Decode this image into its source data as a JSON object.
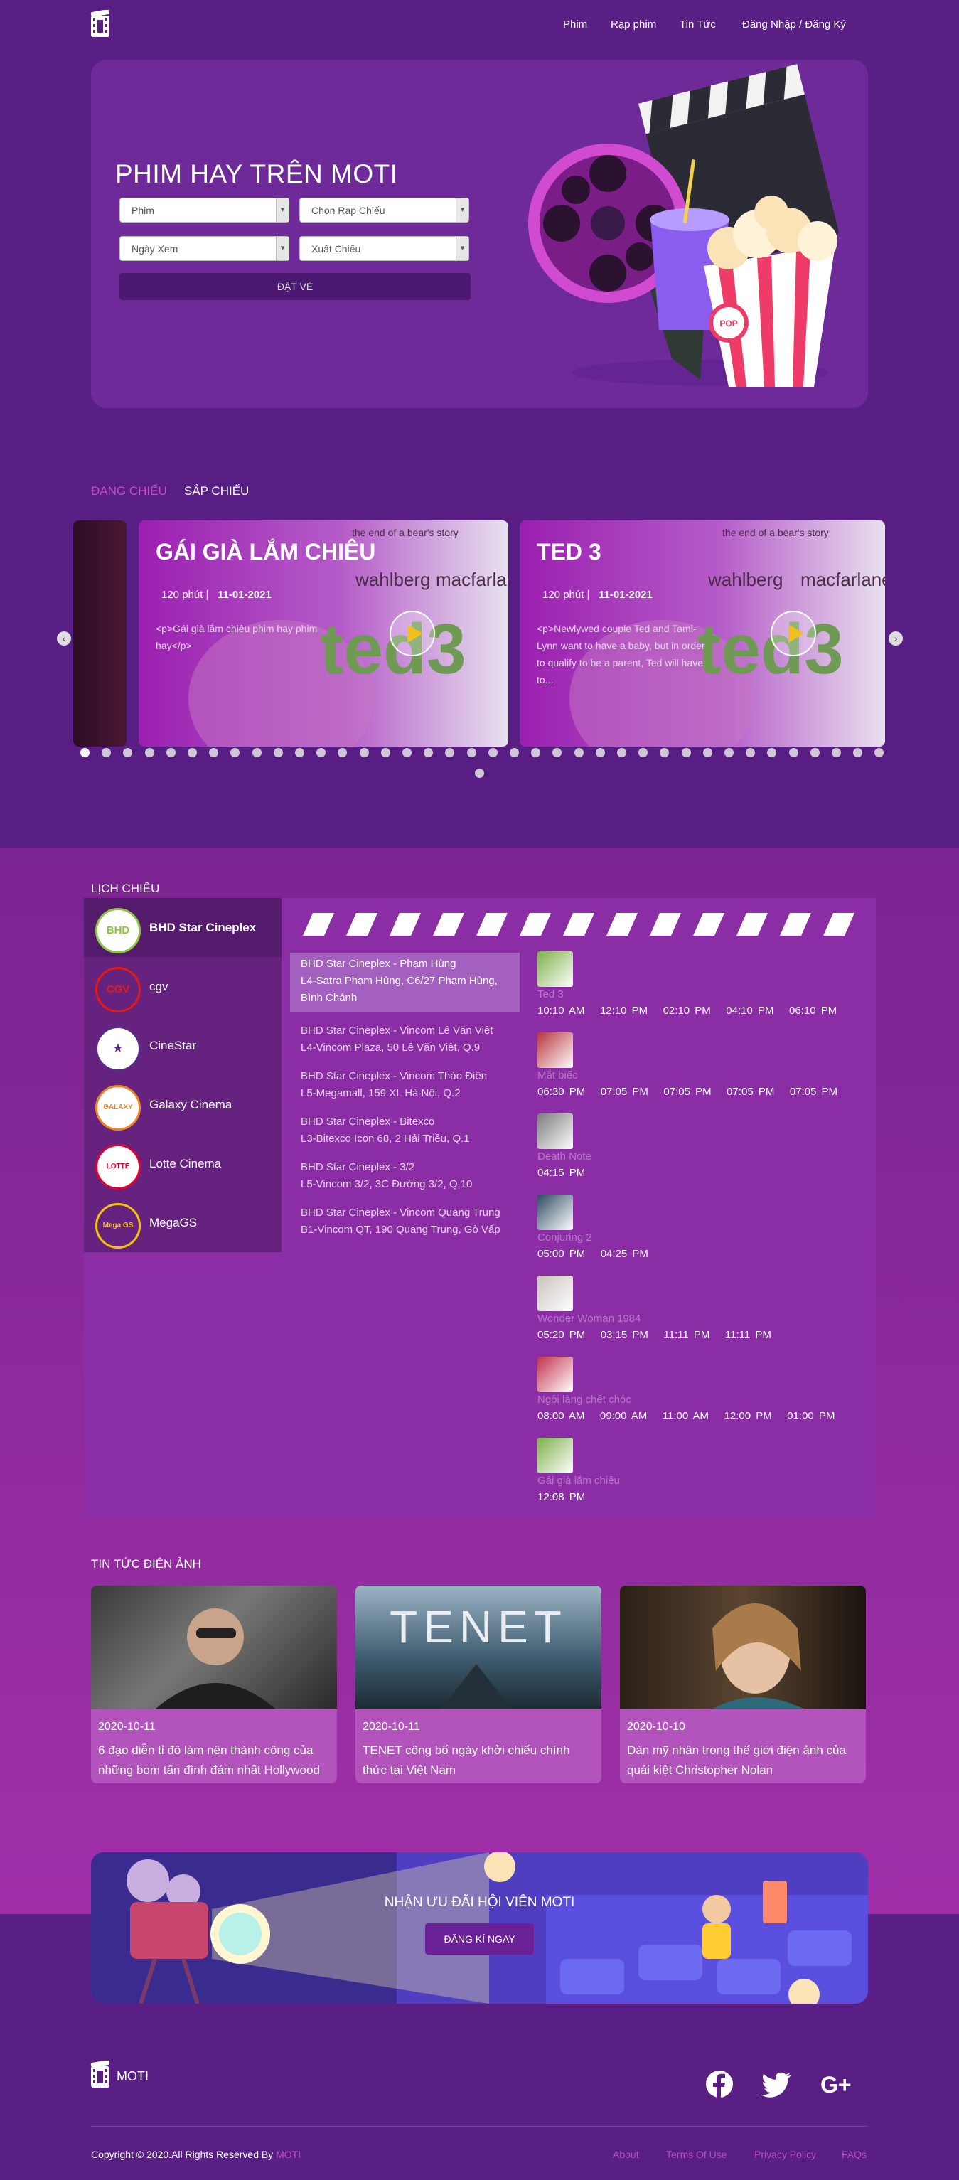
{
  "nav": {
    "items": [
      "Phim",
      "Rạp phim",
      "Tin Tức",
      "Đăng Nhập / Đăng Ký"
    ]
  },
  "hero": {
    "title": "PHIM HAY TRÊN MOTI",
    "film_placeholder": "Phim",
    "cinema_placeholder": "Chọn Rạp Chiếu",
    "date_placeholder": "Ngày Xem",
    "showtime_placeholder": "Xuất Chiếu",
    "book_label": "ĐẶT VÉ"
  },
  "showing": {
    "tab_now": "ĐANG CHIẾU",
    "tab_soon": "SẮP CHIẾU",
    "cards": [
      {
        "title": "GÁI GIÀ LẮM CHIÊU",
        "duration": "120 phút |",
        "date": "11-01-2021",
        "desc": "<p>Gái già lắm chiêu phim hay phim hay</p>"
      },
      {
        "title": "TED 3",
        "duration": "120 phút |",
        "date": "11-01-2021",
        "desc": "<p>Newlywed couple Ted and Tami-Lynn want to have a baby, but in order to qualify to be a parent, Ted will have to..."
      }
    ],
    "poster_text": {
      "tagline": "the end of a bear's story",
      "cast1": "wahlberg",
      "cast2": "macfarlane",
      "logo": "ted3"
    },
    "dots_row1": 38,
    "dots_row2": 1,
    "active_dot": 0
  },
  "schedule": {
    "heading": "LỊCH CHIẾU",
    "cinemas": [
      {
        "name": "BHD Star Cineplex",
        "logo": "BHD",
        "color": "#8cc63f"
      },
      {
        "name": "cgv",
        "logo": "CGV",
        "color": "#e71a0f"
      },
      {
        "name": "CineStar",
        "logo": "★",
        "color": "#5b2a86"
      },
      {
        "name": "Galaxy Cinema",
        "logo": "GALAXY",
        "color": "#f58220"
      },
      {
        "name": "Lotte Cinema",
        "logo": "LOTTE",
        "color": "#e4002b"
      },
      {
        "name": "MegaGS",
        "logo": "Mega GS",
        "color": "#f5c400"
      }
    ],
    "theaters": [
      {
        "name": "BHD Star Cineplex - Phạm Hùng",
        "addr": "L4-Satra Phạm Hùng, C6/27 Phạm Hùng, Bình Chánh"
      },
      {
        "name": "BHD Star Cineplex - Vincom Lê Văn Việt",
        "addr": "L4-Vincom Plaza, 50 Lê Văn Việt, Q.9"
      },
      {
        "name": "BHD Star Cineplex - Vincom Thảo Điền",
        "addr": "L5-Megamall, 159 XL Hà Nội, Q.2"
      },
      {
        "name": "BHD Star Cineplex - Bitexco",
        "addr": "L3-Bitexco Icon 68, 2 Hải Triều, Q.1"
      },
      {
        "name": "BHD Star Cineplex - 3/2",
        "addr": "L5-Vincom 3/2, 3C Đường 3/2, Q.10"
      },
      {
        "name": "BHD Star Cineplex - Vincom Quang Trung",
        "addr": "B1-Vincom QT, 190 Quang Trung, Gò Vấp"
      }
    ],
    "movies": [
      {
        "name": "Ted 3",
        "times": "10:10 AM   12:10 PM   02:10 PM   04:10 PM   06:10 PM",
        "color": "#7fb04a"
      },
      {
        "name": "Mắt biếc",
        "times": "06:30 PM   07:05 PM   07:05 PM   07:05 PM   07:05 PM",
        "color": "#b8343c"
      },
      {
        "name": "Death Note",
        "times": "04:15 PM",
        "color": "#7c7c7c"
      },
      {
        "name": "Conjuring 2",
        "times": "05:00 PM   04:25 PM",
        "color": "#2d4a63"
      },
      {
        "name": "Wonder Woman 1984",
        "times": "05:20 PM   03:15 PM   11:11 PM   11:11 PM",
        "color": "#c9c3bd"
      },
      {
        "name": "Ngôi làng chết chóc",
        "times": "08:00 AM   09:00 AM   11:00 AM   12:00 PM   01:00 PM",
        "color": "#c2314a"
      },
      {
        "name": "Gái già lắm chiêu",
        "times": "12:08 PM",
        "color": "#7fb04a"
      }
    ]
  },
  "news": {
    "heading": "TIN TỨC ĐIỆN ẢNH",
    "items": [
      {
        "date": "2020-10-11",
        "title": "6 đạo diễn tỉ đô làm nên thành công của những bom tấn đình đám nhất Hollywood"
      },
      {
        "date": "2020-10-11",
        "title": "TENET công bố ngày khởi chiếu chính thức tại Việt Nam",
        "img_text": "TENET"
      },
      {
        "date": "2020-10-10",
        "title": "Dàn mỹ nhân trong thế giới điện ảnh của quái kiệt Christopher Nolan"
      }
    ]
  },
  "promo": {
    "title": "NHẬN ƯU ĐÃI HỘI VIÊN MOTI",
    "button": "ĐĂNG KÍ NGAY"
  },
  "footer": {
    "brand": "MOTI",
    "copyright": "Copyright © 2020.All Rights Reserved By",
    "copyright_brand": "MOTI",
    "links": [
      "About",
      "Terms Of Use",
      "Privacy Policy",
      "FAQs"
    ],
    "google_plus": "G+"
  }
}
